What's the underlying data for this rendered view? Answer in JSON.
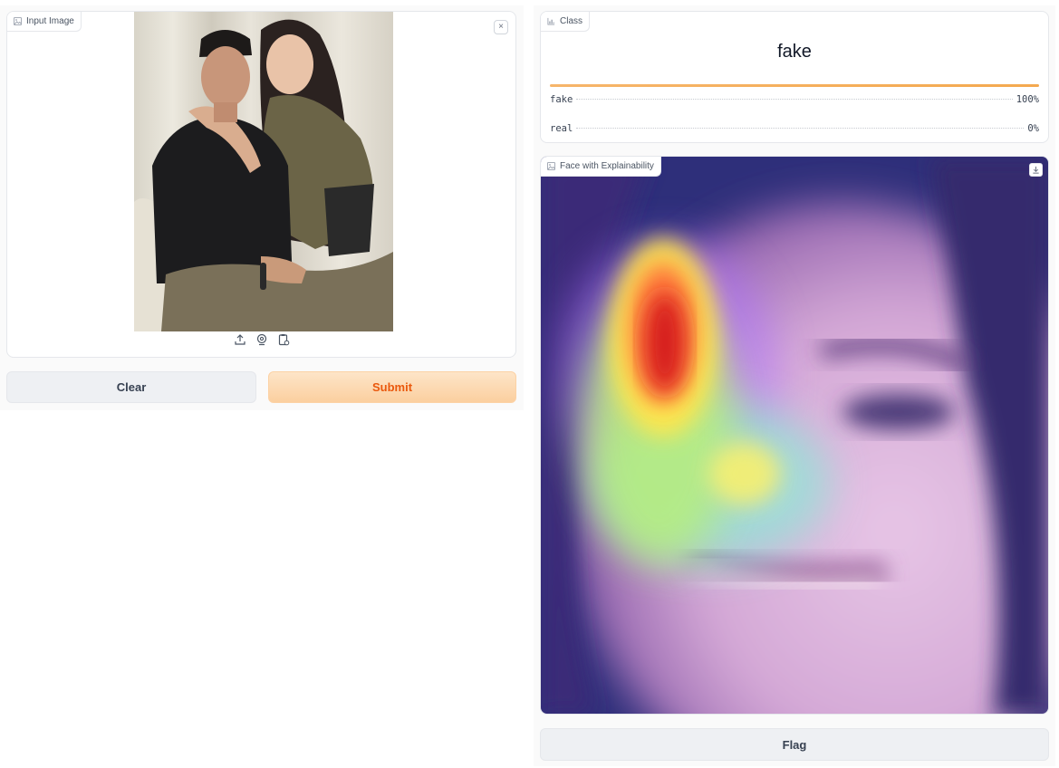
{
  "input_panel": {
    "label": "Input Image",
    "label_icon": "image-icon",
    "close_icon": "close-icon",
    "close_symbol": "×",
    "source_icons": [
      "upload-icon",
      "webcam-icon",
      "clipboard-icon"
    ]
  },
  "buttons": {
    "clear": "Clear",
    "submit": "Submit",
    "flag": "Flag"
  },
  "class_panel": {
    "label": "Class",
    "label_icon": "label-icon",
    "predicted": "fake",
    "confidences": [
      {
        "label": "fake",
        "value": "100%",
        "fraction": 1.0
      },
      {
        "label": "real",
        "value": "0%",
        "fraction": 0.0
      }
    ]
  },
  "explain_panel": {
    "label": "Face with Explainability",
    "label_icon": "image-icon",
    "download_icon": "download-icon"
  },
  "colors": {
    "submit_bg": "#fbcf9f",
    "submit_text": "#ea580c",
    "confidence_bar": "#f4a94f",
    "button_bg": "#eef0f3"
  }
}
